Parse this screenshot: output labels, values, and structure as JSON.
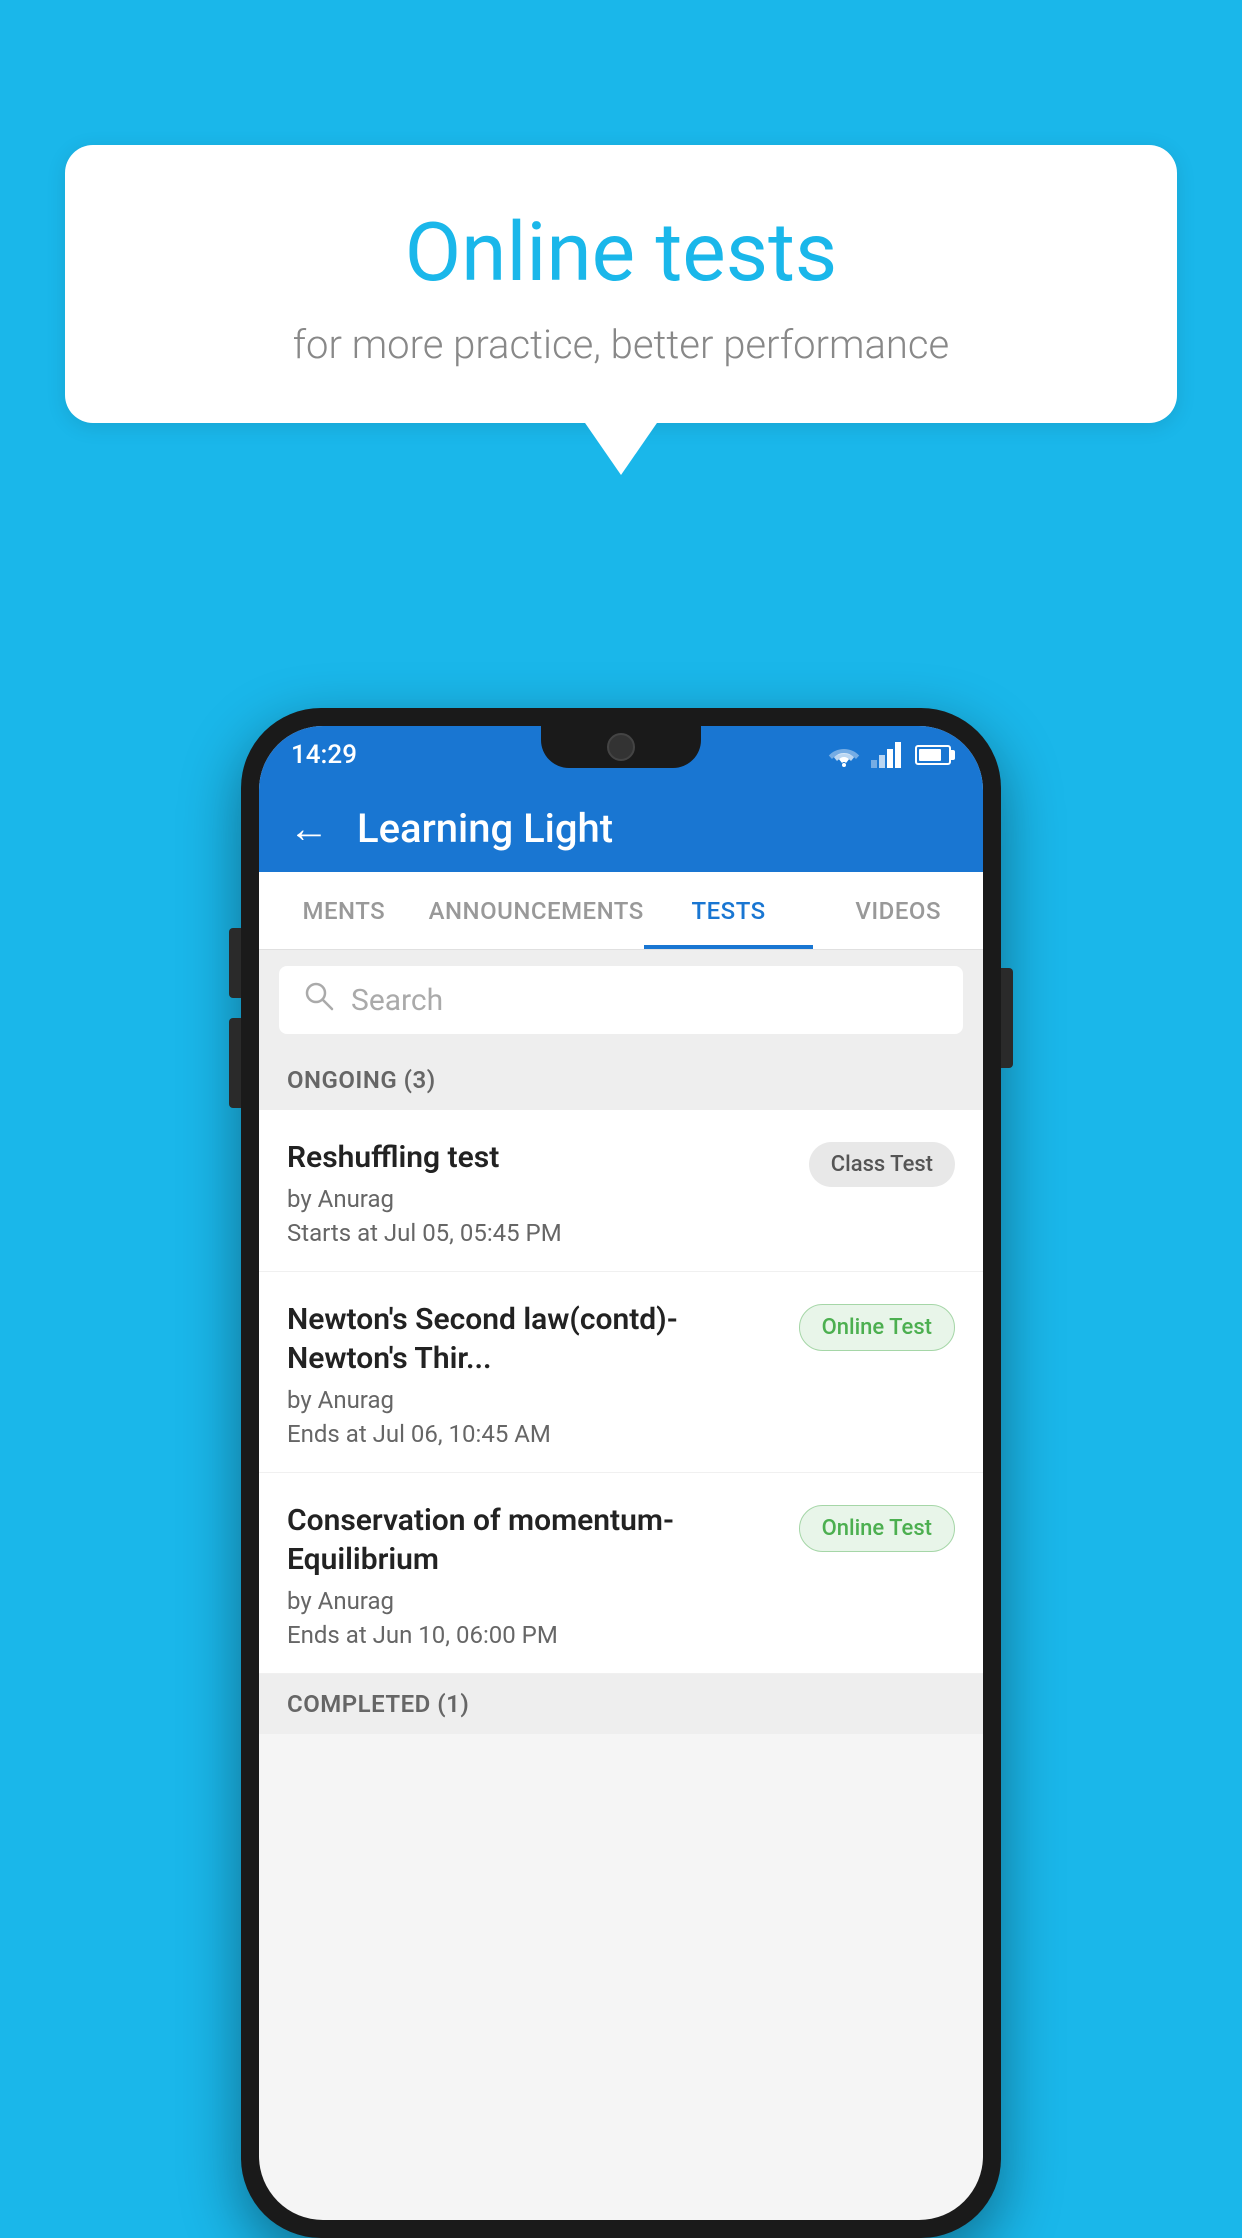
{
  "background": {
    "color": "#1ab7ea"
  },
  "speech_bubble": {
    "title": "Online tests",
    "subtitle": "for more practice, better performance"
  },
  "phone": {
    "status_bar": {
      "time": "14:29",
      "wifi_icon": "▼",
      "signal_icon": "▲",
      "battery_level": "70%"
    },
    "app_header": {
      "back_icon": "←",
      "title": "Learning Light"
    },
    "tabs": [
      {
        "label": "MENTS",
        "active": false
      },
      {
        "label": "ANNOUNCEMENTS",
        "active": false
      },
      {
        "label": "TESTS",
        "active": true
      },
      {
        "label": "VIDEOS",
        "active": false
      }
    ],
    "search": {
      "placeholder": "Search",
      "search_icon": "🔍"
    },
    "ongoing_section": {
      "header": "ONGOING (3)",
      "tests": [
        {
          "title": "Reshuffling test",
          "author": "by Anurag",
          "date": "Starts at  Jul 05, 05:45 PM",
          "badge": "Class Test",
          "badge_type": "class"
        },
        {
          "title": "Newton's Second law(contd)-Newton's Thir...",
          "author": "by Anurag",
          "date": "Ends at  Jul 06, 10:45 AM",
          "badge": "Online Test",
          "badge_type": "online"
        },
        {
          "title": "Conservation of momentum-Equilibrium",
          "author": "by Anurag",
          "date": "Ends at  Jun 10, 06:00 PM",
          "badge": "Online Test",
          "badge_type": "online"
        }
      ]
    },
    "completed_section": {
      "header": "COMPLETED (1)"
    }
  }
}
